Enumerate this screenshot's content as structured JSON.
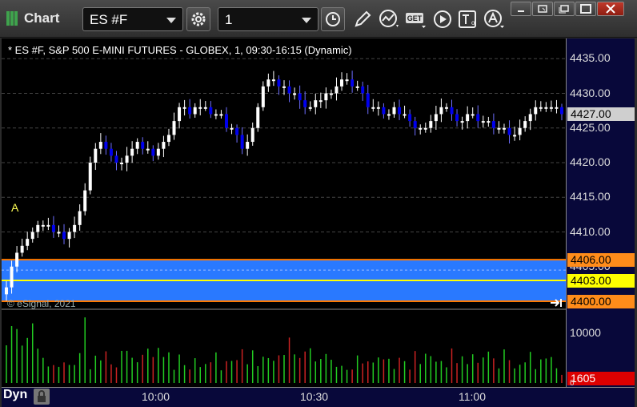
{
  "window": {
    "title": "Chart",
    "icon": "chart-bars-icon"
  },
  "toolbar": {
    "symbol_value": "ES #F",
    "interval_value": "1",
    "buttons": [
      "settings-gear-icon",
      "clock-icon",
      "pencil-draw-icon",
      "study-curve-icon",
      "get-data-icon",
      "play-icon",
      "text-tool-icon",
      "alert-icon"
    ],
    "get_label": "GET"
  },
  "window_controls": [
    "minimize-icon",
    "restore-icon",
    "maximize-icon",
    "close-icon"
  ],
  "chart": {
    "description": "* ES #F, S&P 500 E-MINI FUTURES - GLOBEX, 1, 09:30-16:15 (Dynamic)",
    "copyright": "© eSignal, 2021",
    "marker": "A",
    "colors": {
      "up_candle": "#ffffff",
      "down_candle": "#0000ee",
      "band": "#2979ff",
      "band_border": "#ff7a00",
      "mid_line": "#ffff00",
      "volume_up": "#22cc22",
      "volume_down": "#cc2222"
    },
    "price_axis": [
      "4435.00",
      "4430.00",
      "4425.00",
      "4420.00",
      "4415.00",
      "4410.00",
      "4405.00",
      "4400.00"
    ],
    "price_tags": [
      {
        "value": "4427.00",
        "bg": "#cfcfcf",
        "fg": "#000000"
      },
      {
        "value": "4406.00",
        "bg": "#ff8c1a",
        "fg": "#000000"
      },
      {
        "value": "4403.00",
        "bg": "#ffff00",
        "fg": "#000000"
      },
      {
        "value": "4400.00",
        "bg": "#ff8c1a",
        "fg": "#000000"
      }
    ],
    "volume_axis": [
      "10000",
      "0"
    ],
    "volume_tag": {
      "value": "1605",
      "bg": "#dd0000",
      "fg": "#ffffff"
    },
    "time_axis": [
      "10:00",
      "10:30",
      "11:00"
    ],
    "mode_button": "Dyn"
  },
  "chart_data": {
    "type": "candlestick",
    "title": "* ES #F, S&P 500 E-MINI FUTURES - GLOBEX, 1, 09:30-16:15 (Dynamic)",
    "interval_minutes": 1,
    "session": "09:30-16:15",
    "ylim": [
      4399,
      4437
    ],
    "y_ticks": [
      4400,
      4405,
      4410,
      4415,
      4420,
      4425,
      4430,
      4435
    ],
    "x_ticks": [
      "10:00",
      "10:30",
      "11:00"
    ],
    "last_price": 4427.0,
    "band": {
      "upper": 4406.0,
      "middle": 4403.0,
      "lower": 4400.0
    },
    "close": [
      4402,
      4405,
      4407,
      4408,
      4409,
      4410,
      4411,
      4411,
      4411,
      4410,
      4410,
      4409,
      4410,
      4411,
      4413,
      4416,
      4420,
      4422,
      4423,
      4422,
      4421,
      4420,
      4420,
      4421,
      4422,
      4423,
      4422,
      4422,
      4421,
      4422,
      4423,
      4424,
      4426,
      4428,
      4428,
      4427,
      4428,
      4428,
      4428,
      4427,
      4427,
      4427,
      4425,
      4425,
      4424,
      4422,
      4423,
      4425,
      4428,
      4431,
      4432,
      4432,
      4431,
      4431,
      4430,
      4430,
      4429,
      4428,
      4428,
      4429,
      4429,
      4430,
      4430,
      4431,
      4432,
      4432,
      4431,
      4431,
      4430,
      4428,
      4428,
      4428,
      4427,
      4427,
      4428,
      4427,
      4427,
      4426,
      4425,
      4425,
      4425,
      4426,
      4427,
      4428,
      4428,
      4427,
      4426,
      4426,
      4427,
      4427,
      4426,
      4426,
      4426,
      4425,
      4425,
      4425,
      4424,
      4424,
      4425,
      4426,
      4427,
      4428,
      4428,
      4428,
      4428,
      4428,
      4427
    ],
    "volume_max": 13500,
    "volume_last": 1605
  }
}
